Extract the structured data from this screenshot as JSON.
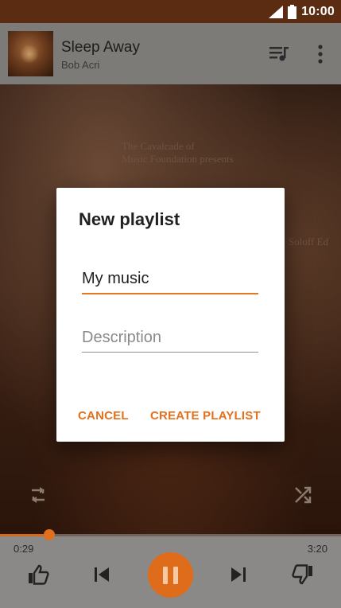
{
  "status_bar": {
    "time": "10:00"
  },
  "now_playing": {
    "title": "Sleep Away",
    "artist": "Bob Acri"
  },
  "artwork": {
    "text_line1": "The Cavalcade of",
    "text_line2": "Music Foundation presents",
    "text_right": "Soloff Ed"
  },
  "player": {
    "elapsed": "0:29",
    "total": "3:20",
    "progress_fraction": 0.145
  },
  "dialog": {
    "title": "New playlist",
    "name_value": "My music",
    "description_placeholder": "Description",
    "cancel_label": "CANCEL",
    "create_label": "CREATE PLAYLIST"
  },
  "colors": {
    "accent": "#e5701c",
    "status_bar": "#5b2c12"
  }
}
